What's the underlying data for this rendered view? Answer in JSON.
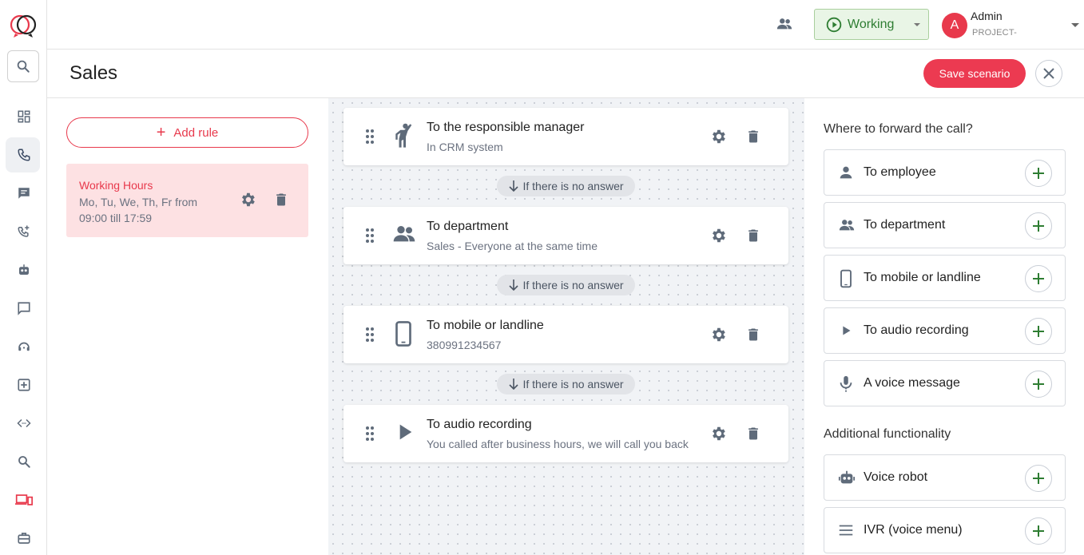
{
  "colors": {
    "accent": "#e8394c",
    "working": "#2e7d32",
    "icon": "#5f6b7a"
  },
  "header": {
    "status_label": "Working",
    "user_initial": "A",
    "user_name": "Admin",
    "user_project": "PROJECT-"
  },
  "page": {
    "title": "Sales",
    "save_label": "Save scenario"
  },
  "rules": {
    "add_label": "Add rule",
    "items": [
      {
        "title": "Working Hours",
        "summary": "Mo, Tu, We, Th, Fr from 09:00 till 17:59"
      }
    ]
  },
  "flow": {
    "no_answer_label": "If there is no answer",
    "steps": [
      {
        "icon": "manager-icon",
        "title": "To the responsible manager",
        "subtitle": "In CRM system"
      },
      {
        "icon": "department-icon",
        "title": "To department",
        "subtitle": "Sales - Everyone at the same time"
      },
      {
        "icon": "mobile-icon",
        "title": "To mobile or landline",
        "subtitle": "380991234567"
      },
      {
        "icon": "play-icon",
        "title": "To audio recording",
        "subtitle": "You called after business hours, we will call you back"
      }
    ]
  },
  "panel": {
    "forward_title": "Where to forward the call?",
    "forward_options": [
      {
        "icon": "person-icon",
        "label": "To employee"
      },
      {
        "icon": "department-icon",
        "label": "To department"
      },
      {
        "icon": "mobile-icon",
        "label": "To mobile or landline"
      },
      {
        "icon": "play-icon",
        "label": "To audio recording"
      },
      {
        "icon": "microphone-icon",
        "label": "A voice message"
      }
    ],
    "additional_title": "Additional functionality",
    "additional_options": [
      {
        "icon": "robot-icon",
        "label": "Voice robot"
      },
      {
        "icon": "menu-icon",
        "label": "IVR (voice menu)"
      }
    ]
  }
}
